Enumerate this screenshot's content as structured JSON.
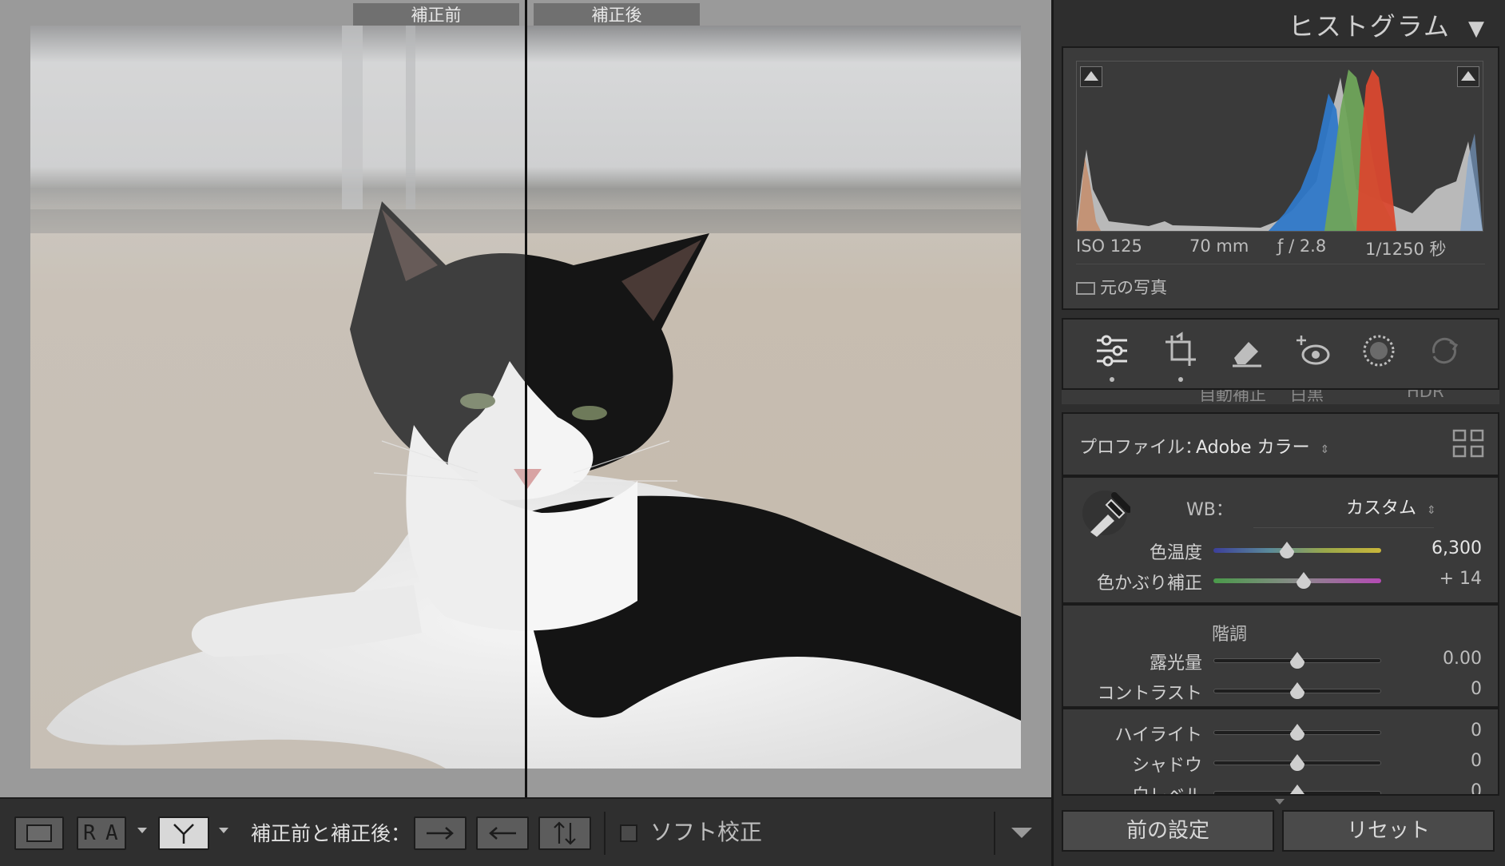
{
  "view": {
    "before_label": "補正前",
    "after_label": "補正後"
  },
  "toolbar": {
    "view_mode_letters": [
      "R",
      "A"
    ],
    "before_after_label": "補正前と補正後：",
    "soft_proof_label": "ソフト校正"
  },
  "panel": {
    "histogram_title": "ヒストグラム",
    "histogram_toggle": "▼",
    "exif": {
      "iso": "ISO 125",
      "focal": "70 mm",
      "aperture": "ƒ / 2.8",
      "shutter": "1/1250 秒"
    },
    "original_photo_label": "元の写真",
    "tools": [
      "edit-sliders-icon",
      "crop-icon",
      "healing-eraser-icon",
      "red-eye-icon",
      "mask-icon",
      "preset-sync-icon"
    ],
    "partial_buttons": [
      "自動補正",
      "白黒",
      "HDR"
    ],
    "profile": {
      "label": "プロファイル：",
      "value": "Adobe カラー"
    },
    "wb": {
      "label": "WB：",
      "value": "カスタム"
    },
    "sliders_color": [
      {
        "label": "色温度",
        "value": "6,300",
        "position": 0.44
      },
      {
        "label": "色かぶり補正",
        "value": "+ 14",
        "position": 0.54
      }
    ],
    "tone_heading": "階調",
    "sliders_tone": [
      {
        "label": "露光量",
        "value": "0.00",
        "position": 0.5
      },
      {
        "label": "コントラスト",
        "value": "0",
        "position": 0.5
      }
    ],
    "sliders_presence": [
      {
        "label": "ハイライト",
        "value": "0",
        "position": 0.5
      },
      {
        "label": "シャドウ",
        "value": "0",
        "position": 0.5
      },
      {
        "label": "白レベル",
        "value": "0",
        "position": 0.5
      }
    ],
    "buttons": {
      "previous": "前の設定",
      "reset": "リセット"
    }
  },
  "colors": {
    "accent_histogram_red": "#d9482f",
    "accent_histogram_green": "#6fa45a",
    "accent_histogram_blue": "#2f78c8"
  }
}
